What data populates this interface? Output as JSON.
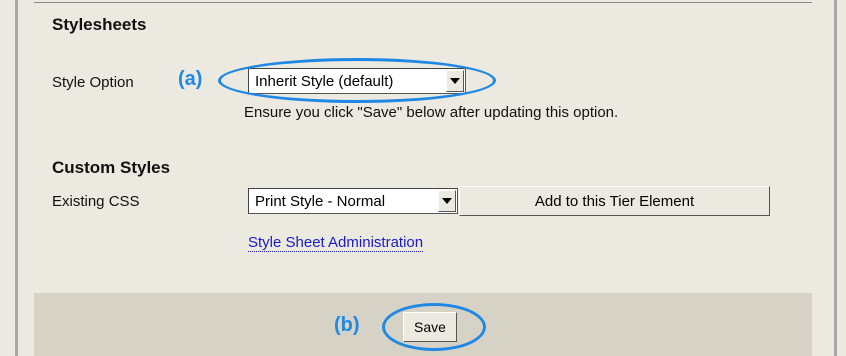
{
  "stylesheets": {
    "heading": "Stylesheets",
    "style_option_label": "Style Option",
    "style_option_value": "Inherit Style (default)",
    "note": "Ensure you click \"Save\" below after updating this option."
  },
  "custom_styles": {
    "heading": "Custom Styles",
    "existing_css_label": "Existing CSS",
    "existing_css_value": "Print Style - Normal",
    "add_button_label": "Add to this Tier Element",
    "admin_link": "Style Sheet Administration"
  },
  "footer": {
    "save_label": "Save"
  },
  "annotations": {
    "marker_a": "(a)",
    "marker_b": "(b)",
    "highlight_color": "#1e88e5"
  },
  "icons": {
    "dropdown_arrow": "chevron-down-icon"
  }
}
